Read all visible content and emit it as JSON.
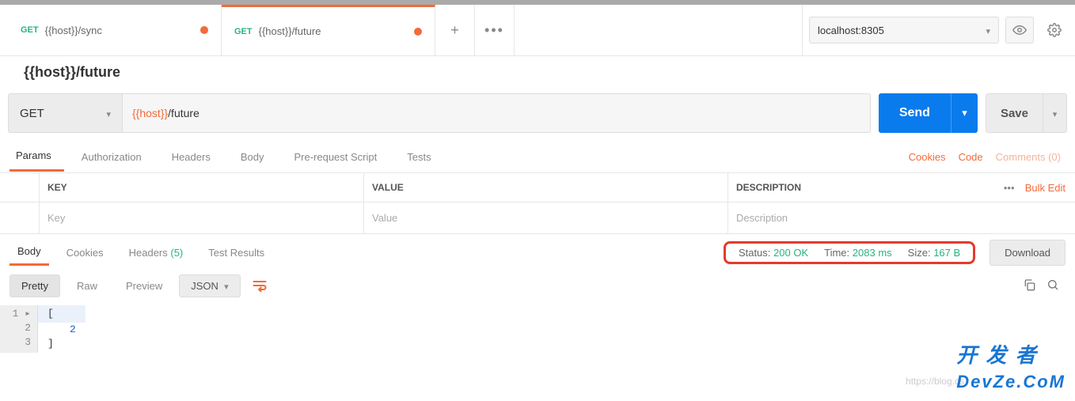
{
  "tabs": [
    {
      "method": "GET",
      "path": "{{host}}/sync",
      "dirty": true,
      "active": false
    },
    {
      "method": "GET",
      "path": "{{host}}/future",
      "dirty": true,
      "active": true
    }
  ],
  "env": {
    "selected": "localhost:8305"
  },
  "request": {
    "title": "{{host}}/future",
    "method": "GET",
    "url_var": "{{host}}",
    "url_rest": "/future",
    "send_label": "Send",
    "save_label": "Save"
  },
  "subtabs": {
    "labels": [
      "Params",
      "Authorization",
      "Headers",
      "Body",
      "Pre-request Script",
      "Tests"
    ],
    "active": "Params",
    "links": {
      "cookies": "Cookies",
      "code": "Code",
      "comments": "Comments (0)"
    }
  },
  "params": {
    "head": {
      "key": "KEY",
      "value": "VALUE",
      "desc": "DESCRIPTION",
      "bulk": "Bulk Edit"
    },
    "placeholders": {
      "key": "Key",
      "value": "Value",
      "desc": "Description"
    }
  },
  "response": {
    "tabs": {
      "body": "Body",
      "cookies": "Cookies",
      "headers_label": "Headers",
      "headers_badge": "(5)",
      "tests": "Test Results"
    },
    "status": {
      "label": "Status:",
      "value": "200 OK",
      "time_label": "Time:",
      "time_value": "2083 ms",
      "size_label": "Size:",
      "size_value": "167 B"
    },
    "download": "Download",
    "view": {
      "pretty": "Pretty",
      "raw": "Raw",
      "preview": "Preview",
      "fmt": "JSON"
    },
    "body_lines": [
      "[",
      "    2",
      "]"
    ]
  },
  "watermark": {
    "blog": "https://blog.cs",
    "brand1": "开 发 者",
    "brand2": "DevZe.CoM"
  }
}
